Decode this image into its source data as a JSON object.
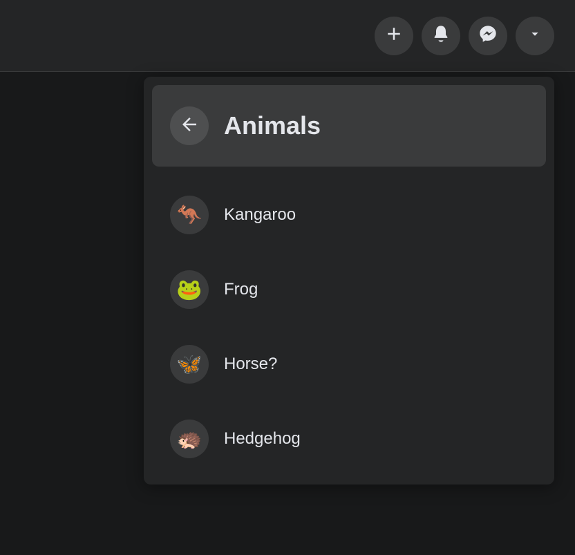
{
  "menu": {
    "title": "Animals",
    "items": [
      {
        "emoji": "🦘",
        "label": "Kangaroo"
      },
      {
        "emoji": "🐸",
        "label": "Frog"
      },
      {
        "emoji": "🦋",
        "label": "Horse?"
      },
      {
        "emoji": "🦔",
        "label": "Hedgehog"
      }
    ]
  }
}
